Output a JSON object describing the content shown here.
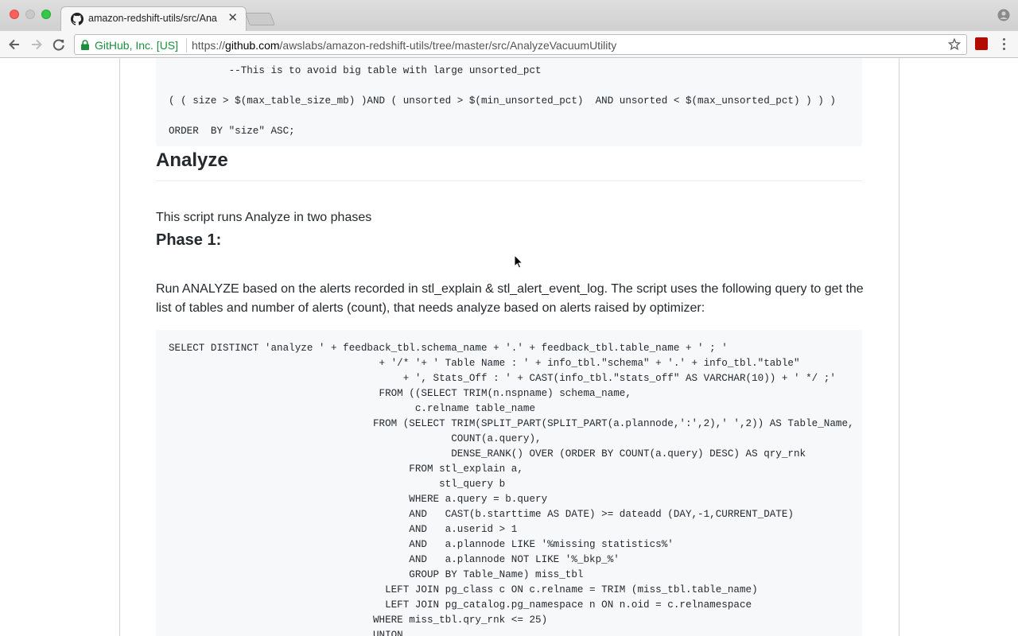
{
  "browser": {
    "tab": {
      "title": "amazon-redshift-utils/src/Ana"
    },
    "security_label": "GitHub, Inc. [US]",
    "url_scheme": "https://",
    "url_host": "github.com",
    "url_path": "/awslabs/amazon-redshift-utils/tree/master/src/AnalyzeVacuumUtility"
  },
  "readme": {
    "code_block_1": [
      "          --This is to avoid big table with large unsorted_pct",
      "",
      "( ( size > $(max_table_size_mb) )AND ( unsorted > $(min_unsorted_pct)  AND unsorted < $(max_unsorted_pct) ) ) )",
      "",
      "ORDER  BY \"size\" ASC;"
    ],
    "heading_analyze": "Analyze",
    "intro": "This script runs Analyze in two phases",
    "heading_phase1": "Phase 1:",
    "phase1_desc": "Run ANALYZE based on the alerts recorded in stl_explain & stl_alert_event_log. The script uses the following query to get the list of tables and number of alerts (count), that needs analyze based on alerts raised by optimizer:",
    "code_block_2": [
      "SELECT DISTINCT 'analyze ' + feedback_tbl.schema_name + '.' + feedback_tbl.table_name + ' ; '",
      "                                   + '/* '+ ' Table Name : ' + info_tbl.\"schema\" + '.' + info_tbl.\"table\"",
      "                                       + ', Stats_Off : ' + CAST(info_tbl.\"stats_off\" AS VARCHAR(10)) + ' */ ;'",
      "                                   FROM ((SELECT TRIM(n.nspname) schema_name,",
      "                                         c.relname table_name",
      "                                  FROM (SELECT TRIM(SPLIT_PART(SPLIT_PART(a.plannode,':',2),' ',2)) AS Table_Name,",
      "                                               COUNT(a.query),",
      "                                               DENSE_RANK() OVER (ORDER BY COUNT(a.query) DESC) AS qry_rnk",
      "                                        FROM stl_explain a,",
      "                                             stl_query b",
      "                                        WHERE a.query = b.query",
      "                                        AND   CAST(b.starttime AS DATE) >= dateadd (DAY,-1,CURRENT_DATE)",
      "                                        AND   a.userid > 1",
      "                                        AND   a.plannode LIKE '%missing statistics%'",
      "                                        AND   a.plannode NOT LIKE '%_bkp_%'",
      "                                        GROUP BY Table_Name) miss_tbl",
      "                                    LEFT JOIN pg_class c ON c.relname = TRIM (miss_tbl.table_name)",
      "                                    LEFT JOIN pg_catalog.pg_namespace n ON n.oid = c.relnamespace",
      "                                  WHERE miss_tbl.qry_rnk <= 25)",
      "                                  UNION"
    ]
  }
}
